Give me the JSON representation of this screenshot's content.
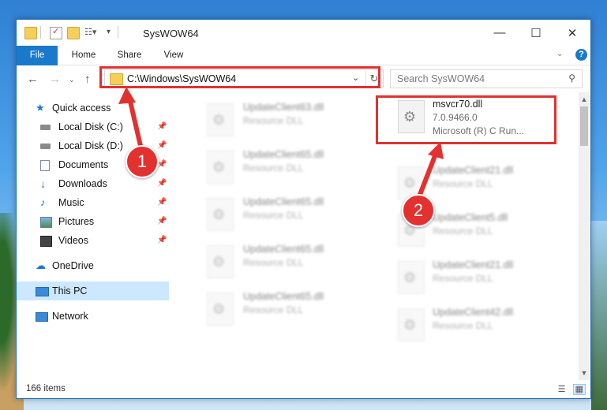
{
  "window": {
    "title": "SysWOW64",
    "controls": {
      "minimize": "—",
      "maximize": "☐",
      "close": "✕"
    }
  },
  "ribbon": {
    "tabs": [
      {
        "label": "File"
      },
      {
        "label": "Home"
      },
      {
        "label": "Share"
      },
      {
        "label": "View"
      }
    ],
    "help": "?"
  },
  "address": {
    "path": "C:\\Windows\\SysWOW64",
    "search_placeholder": "Search SysWOW64"
  },
  "nav": {
    "items": [
      {
        "label": "Quick access",
        "icon": "star-icon"
      },
      {
        "label": "Local Disk (C:)",
        "icon": "drive-icon",
        "pinned": true
      },
      {
        "label": "Local Disk (D:)",
        "icon": "drive-icon",
        "pinned": true
      },
      {
        "label": "Documents",
        "icon": "documents-icon",
        "pinned": true
      },
      {
        "label": "Downloads",
        "icon": "downloads-icon",
        "pinned": true
      },
      {
        "label": "Music",
        "icon": "music-icon",
        "pinned": true
      },
      {
        "label": "Pictures",
        "icon": "pictures-icon",
        "pinned": true
      },
      {
        "label": "Videos",
        "icon": "videos-icon",
        "pinned": true
      },
      {
        "label": "OneDrive",
        "icon": "cloud-icon"
      },
      {
        "label": "This PC",
        "icon": "computer-icon",
        "selected": true
      },
      {
        "label": "Network",
        "icon": "network-icon"
      }
    ]
  },
  "files": {
    "highlighted": {
      "name": "msvcr70.dll",
      "version": "7.0.9466.0",
      "company": "Microsoft (R) C Run..."
    },
    "left_column": [
      {
        "name": "UpdateClient63.dll",
        "type": "Resource DLL"
      },
      {
        "name": "UpdateClient65.dll",
        "type": "Resource DLL"
      },
      {
        "name": "UpdateClient65.dll",
        "type": "Resource DLL"
      },
      {
        "name": "UpdateClient65.dll",
        "type": "Resource DLL"
      },
      {
        "name": "UpdateClient65.dll",
        "type": "Resource DLL"
      }
    ],
    "right_column": [
      {
        "name": "UpdateClient21.dll",
        "type": "Resource DLL"
      },
      {
        "name": "UpdateClient5.dll",
        "type": "Resource DLL"
      },
      {
        "name": "UpdateClient21.dll",
        "type": "Resource DLL"
      },
      {
        "name": "UpdateClient42.dll",
        "type": "Resource DLL"
      }
    ]
  },
  "status": {
    "items_count": "166 items"
  },
  "markers": {
    "one": "1",
    "two": "2"
  },
  "colors": {
    "accent": "#1979ca",
    "highlight": "#e2312f",
    "selected_bg": "#cce8ff"
  }
}
